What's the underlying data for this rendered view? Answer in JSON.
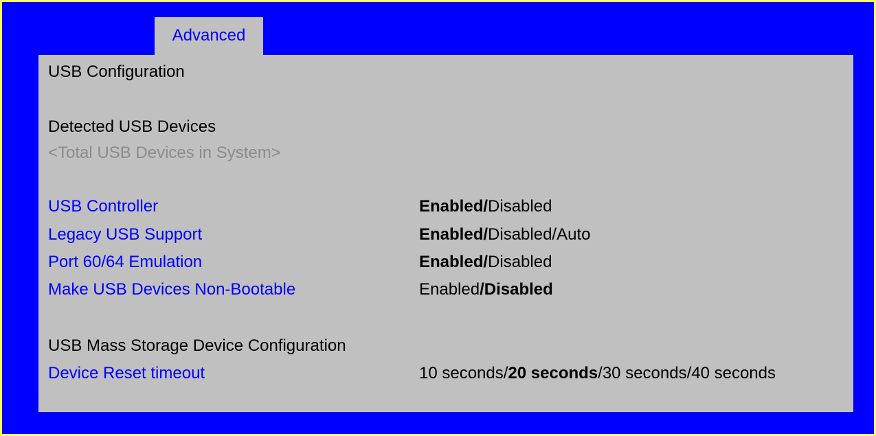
{
  "tab": {
    "label": "Advanced"
  },
  "title": "USB Configuration",
  "detected_section": {
    "heading": "Detected USB Devices",
    "info": "<Total USB Devices in System>"
  },
  "settings": [
    {
      "name": "USB Controller",
      "options": [
        {
          "text": "Enabled",
          "default": true
        },
        {
          "text": "/",
          "default": true
        },
        {
          "text": "Disabled",
          "default": false
        }
      ]
    },
    {
      "name": "Legacy USB Support",
      "options": [
        {
          "text": "Enabled",
          "default": true
        },
        {
          "text": "/",
          "default": true
        },
        {
          "text": "Disabled/Auto",
          "default": false
        }
      ]
    },
    {
      "name": "Port 60/64 Emulation",
      "options": [
        {
          "text": "Enabled",
          "default": true
        },
        {
          "text": "/",
          "default": true
        },
        {
          "text": "Disabled",
          "default": false
        }
      ]
    },
    {
      "name": "Make USB Devices Non-Bootable",
      "options": [
        {
          "text": "Enabled",
          "default": false
        },
        {
          "text": "/",
          "default": true
        },
        {
          "text": "Disabled",
          "default": true
        }
      ]
    }
  ],
  "mass_storage": {
    "heading": "USB Mass Storage Device Configuration",
    "setting": {
      "name": "Device Reset timeout",
      "options": [
        {
          "text": "10 seconds/",
          "default": false
        },
        {
          "text": "20 seconds",
          "default": true
        },
        {
          "text": "/30 seconds/40 seconds",
          "default": false
        }
      ]
    }
  },
  "colors": {
    "background": "#0000ff",
    "panel": "#c0c0c0",
    "frame_border": "#ffff66",
    "link": "#0000ff",
    "info": "#8c8c8c"
  }
}
